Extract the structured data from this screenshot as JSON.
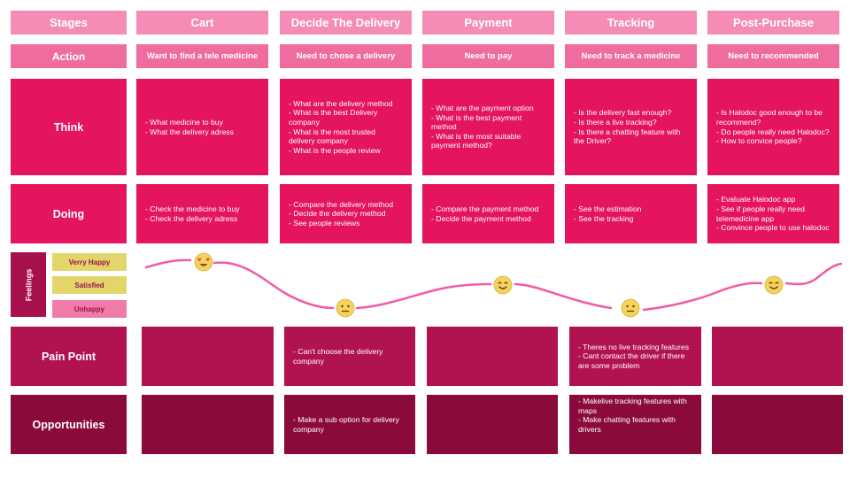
{
  "stages_label": "Stages",
  "stages": [
    "Cart",
    "Decide The Delivery",
    "Payment",
    "Tracking",
    "Post-Purchase"
  ],
  "action_label": "Action",
  "actions": [
    "Want to find a tele medicine",
    "Need to chose a delivery",
    "Need to pay",
    "Need to track a medicine",
    "Need to recommended"
  ],
  "think_label": "Think",
  "think": [
    [
      "- What medicine to buy",
      "- What the delivery adress"
    ],
    [
      "- What are the delivery method",
      "- What is the best Delivery company",
      "- What is the most trusted delivery company",
      "- What is the people review"
    ],
    [
      "- What are the payment option",
      "- What is the best payment method",
      "- What is the most suitable payment method?"
    ],
    [
      "- Is the delivery fast enough?",
      "- Is there a live tracking?",
      "- Is there a chatting feature with the Driver?"
    ],
    [
      "- Is Halodoc good enough to be recommend?",
      "- Do people really need Halodoc?",
      "- How to convice people?"
    ]
  ],
  "doing_label": "Doing",
  "doing": [
    [
      "- Check the medicine to buy",
      "- Check the delivery adress"
    ],
    [
      "- Compare the delivery method",
      "- Decide the delivery method",
      "- See people reviews"
    ],
    [
      "- Compare the payment method",
      "- Decide the payment method"
    ],
    [
      "- See the estimation",
      "- See the tracking"
    ],
    [
      "- Evaluate Halodoc app",
      "- See if people really need telemedicine app",
      "- Convince people to use halodoc"
    ]
  ],
  "feelings_label": "Feelings",
  "feelings_legend": [
    "Verry Happy",
    "Satisfied",
    "Unhappy"
  ],
  "feelings_levels": [
    {
      "stage": "Cart",
      "feeling": "Verry Happy",
      "icon": "heart-eyes-emoji-icon"
    },
    {
      "stage": "Decide The Delivery",
      "feeling": "Neutral",
      "icon": "neutral-face-emoji-icon"
    },
    {
      "stage": "Payment",
      "feeling": "Satisfied",
      "icon": "smiling-face-emoji-icon"
    },
    {
      "stage": "Tracking",
      "feeling": "Neutral",
      "icon": "neutral-face-emoji-icon"
    },
    {
      "stage": "Post-Purchase",
      "feeling": "Satisfied",
      "icon": "smiling-face-emoji-icon"
    }
  ],
  "pain_label": "Pain Point",
  "pain": [
    [],
    [
      "- Can't choose the delivery company"
    ],
    [],
    [
      "- Theres no live tracking features",
      "- Cant contact the driver if there are some problem"
    ],
    []
  ],
  "opp_label": "Opportunities",
  "opp": [
    [],
    [
      "- Make a sub option for delivery company"
    ],
    [],
    [
      "- Makelive tracking features with maps",
      "- Make chatting features with drivers"
    ],
    []
  ],
  "colors": {
    "header": "#f48cb6",
    "action": "#ef6c9f",
    "think_doing": "#e4145f",
    "pain_point": "#b11250",
    "opportunities": "#8b0a3c",
    "curve": "#f25aa6",
    "legend_happy": "#e2d66a",
    "legend_unhappy": "#f07aa8"
  }
}
